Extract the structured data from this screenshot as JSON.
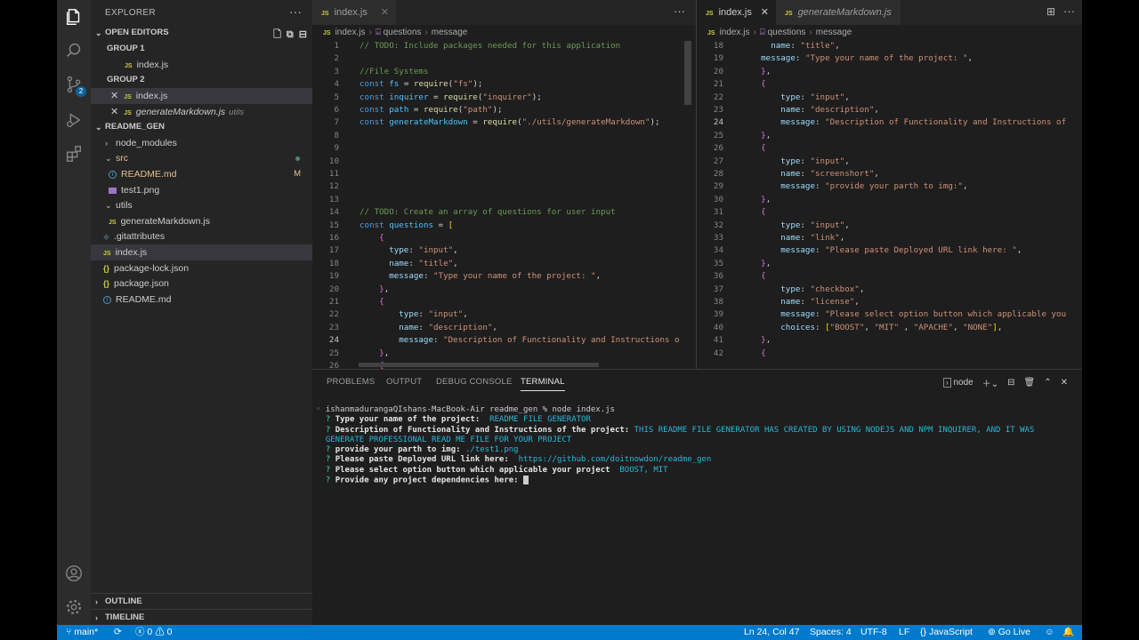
{
  "sidebar": {
    "title": "EXPLORER",
    "open_editors": {
      "heading": "OPEN EDITORS",
      "group1_label": "GROUP 1",
      "group1_file": "index.js",
      "group2_label": "GROUP 2",
      "group2_file1": "index.js",
      "group2_file2": "generateMarkdown.js",
      "group2_file2_hint": "utils"
    },
    "project": {
      "heading": "README_GEN",
      "items": [
        {
          "label": "node_modules"
        },
        {
          "label": "src"
        },
        {
          "label": "README.md",
          "status": "M"
        },
        {
          "label": "test1.png"
        },
        {
          "label": "utils"
        },
        {
          "label": "generateMarkdown.js"
        },
        {
          "label": ".gitattributes"
        },
        {
          "label": "index.js"
        },
        {
          "label": "package-lock.json"
        },
        {
          "label": "package.json"
        },
        {
          "label": "README.md"
        }
      ]
    },
    "outline_label": "OUTLINE",
    "timeline_label": "TIMELINE"
  },
  "activity_badge": "2",
  "editor_left": {
    "tab_label": "index.js",
    "breadcrumb": [
      "index.js",
      "questions",
      "message"
    ],
    "lines": [
      {
        "n": "1",
        "t": "// TODO: Include packages needed for this application"
      },
      {
        "n": "2",
        "t": ""
      },
      {
        "n": "3",
        "t": "//File Systems"
      },
      {
        "n": "4",
        "t": "const fs = require(\"fs\");"
      },
      {
        "n": "5",
        "t": "const inquirer = require(\"inquirer\");"
      },
      {
        "n": "6",
        "t": "const path = require(\"path\");"
      },
      {
        "n": "7",
        "t": "const generateMarkdown = require(\"./utils/generateMarkdown\");"
      },
      {
        "n": "8",
        "t": ""
      },
      {
        "n": "9",
        "t": ""
      },
      {
        "n": "10",
        "t": ""
      },
      {
        "n": "11",
        "t": ""
      },
      {
        "n": "12",
        "t": ""
      },
      {
        "n": "13",
        "t": ""
      },
      {
        "n": "14",
        "t": "// TODO: Create an array of questions for user input"
      },
      {
        "n": "15",
        "t": "const questions = ["
      },
      {
        "n": "16",
        "t": "    {"
      },
      {
        "n": "17",
        "t": "      type: \"input\","
      },
      {
        "n": "18",
        "t": "      name: \"title\","
      },
      {
        "n": "19",
        "t": "      message: \"Type your name of the project: \","
      },
      {
        "n": "20",
        "t": "    },"
      },
      {
        "n": "21",
        "t": "    {"
      },
      {
        "n": "22",
        "t": "        type: \"input\","
      },
      {
        "n": "23",
        "t": "        name: \"description\","
      },
      {
        "n": "24",
        "t": "        message: \"Description of Functionality and Instructions o"
      },
      {
        "n": "25",
        "t": "    },"
      },
      {
        "n": "26",
        "t": "    {"
      }
    ]
  },
  "editor_right": {
    "tab_label": "index.js",
    "tab2_label": "generateMarkdown.js",
    "breadcrumb": [
      "index.js",
      "questions",
      "message"
    ],
    "lines": [
      {
        "n": "18",
        "t": "      name: \"title\","
      },
      {
        "n": "19",
        "t": "    message: \"Type your name of the project: \","
      },
      {
        "n": "20",
        "t": "    },"
      },
      {
        "n": "21",
        "t": "    {"
      },
      {
        "n": "22",
        "t": "        type: \"input\","
      },
      {
        "n": "23",
        "t": "        name: \"description\","
      },
      {
        "n": "24",
        "t": "        message: \"Description of Functionality and Instructions of"
      },
      {
        "n": "25",
        "t": "    },"
      },
      {
        "n": "26",
        "t": "    {"
      },
      {
        "n": "27",
        "t": "        type: \"input\","
      },
      {
        "n": "28",
        "t": "        name: \"screenshort\","
      },
      {
        "n": "29",
        "t": "        message: \"provide your parth to img:\","
      },
      {
        "n": "30",
        "t": "    },"
      },
      {
        "n": "31",
        "t": "    {"
      },
      {
        "n": "32",
        "t": "        type: \"input\","
      },
      {
        "n": "33",
        "t": "        name: \"link\","
      },
      {
        "n": "34",
        "t": "        message: \"Please paste Deployed URL link here: \","
      },
      {
        "n": "35",
        "t": "    },"
      },
      {
        "n": "36",
        "t": "    {"
      },
      {
        "n": "37",
        "t": "        type: \"checkbox\","
      },
      {
        "n": "38",
        "t": "        name: \"license\","
      },
      {
        "n": "39",
        "t": "        message: \"Please select option button which applicable you"
      },
      {
        "n": "40",
        "t": "        choices: [\"BOOST\", \"MIT\" , \"APACHE\", \"NONE\"],"
      },
      {
        "n": "41",
        "t": "    },"
      },
      {
        "n": "42",
        "t": "    {"
      }
    ]
  },
  "panel": {
    "tabs": [
      "PROBLEMS",
      "OUTPUT",
      "DEBUG CONSOLE",
      "TERMINAL"
    ],
    "shell_label": "node",
    "terminal": {
      "prompt_line": "ishanmadurangaQIshans-MacBook-Air readme_gen % node index.js",
      "q1": "Type your name of the project: ",
      "a1": "README FILE GENERATOR",
      "q2": "Description of Functionality and Instructions of the project: ",
      "a2a": "THIS README FILE GENERATOR HAS CREATED BY USING NODEJS AND NPM INQUIRER, AND IT WAS",
      "a2b": "GENERATE PROFESSIONAL READ ME FILE FOR YOUR PROJECT",
      "q3": "provide your parth to img: ",
      "a3": "./test1.png",
      "q4": "Please paste Deployed URL link here: ",
      "a4": "https://github.com/doitnowdon/readme_gen",
      "q5": "Please select option button which applicable your project ",
      "a5": "BOOST, MIT",
      "q6": "Provide any project dependencies here: ",
      "qmark": "?"
    }
  },
  "statusbar": {
    "branch": "main*",
    "errors": "0",
    "warnings": "0",
    "position": "Ln 24, Col 47",
    "spaces": "Spaces: 4",
    "encoding": "UTF-8",
    "eol": "LF",
    "language": "JavaScript",
    "golive": "Go Live"
  },
  "colors": {
    "accent": "#007acc",
    "sidebar": "#252526",
    "editor": "#1e1e1e"
  }
}
